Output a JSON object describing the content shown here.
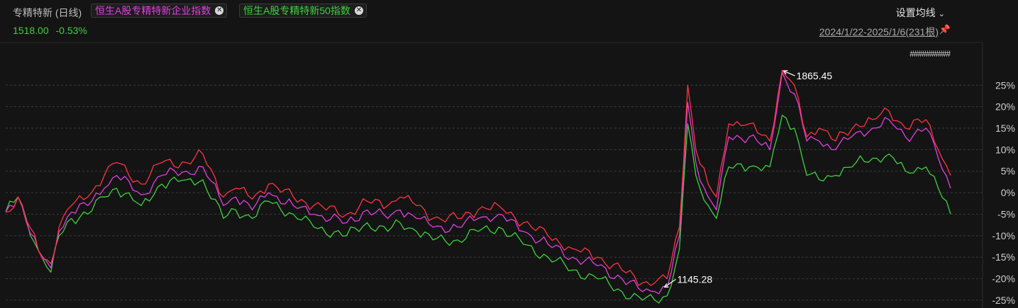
{
  "header": {
    "title": "专精特新 (日线)",
    "tags": [
      {
        "label": "恒生A股专精特新企业指数",
        "color": "#e040e0"
      },
      {
        "label": "恒生A股专精特新50指数",
        "color": "#3fd03f"
      }
    ],
    "settings_label": "设置均线",
    "range_label": "2024/1/22-2025/1/6(231根)",
    "strip_label": "##########"
  },
  "quote": {
    "price": "1518.00",
    "change": "-0.53%"
  },
  "colors": {
    "series_main": "#ff3344",
    "series_magenta": "#e040e0",
    "series_green": "#3fd03f",
    "grid": "#3a3a3a",
    "axis_text": "#cfcfcf"
  },
  "chart_data": {
    "type": "line",
    "ylim": [
      -26,
      29
    ],
    "yticks": [
      25,
      20,
      15,
      10,
      5,
      0,
      -5,
      -10,
      -15,
      -20,
      -25
    ],
    "ytick_labels": [
      "25%",
      "20%",
      "15%",
      "10%",
      "5%",
      "0%",
      "-5%",
      "-10%",
      "-15%",
      "-20%",
      "-25%"
    ],
    "grid": true,
    "x_count": 231,
    "annotations": [
      {
        "label": "1865.45",
        "x": 189,
        "y": 28.5,
        "side": "right"
      },
      {
        "label": "1145.28",
        "x": 160,
        "y": -21.8,
        "side": "right"
      }
    ],
    "anchors": {
      "main": [
        [
          0,
          -4.5
        ],
        [
          3,
          -1
        ],
        [
          8,
          -13.5
        ],
        [
          11,
          -16.5
        ],
        [
          13,
          -8
        ],
        [
          16,
          -3
        ],
        [
          20,
          -1
        ],
        [
          24,
          4
        ],
        [
          27,
          7
        ],
        [
          33,
          2
        ],
        [
          38,
          7
        ],
        [
          44,
          7
        ],
        [
          48,
          9
        ],
        [
          53,
          -1
        ],
        [
          56,
          1
        ],
        [
          60,
          -1.5
        ],
        [
          64,
          2
        ],
        [
          70,
          -1
        ],
        [
          75,
          -3
        ],
        [
          83,
          -5
        ],
        [
          88,
          -2
        ],
        [
          93,
          -3
        ],
        [
          96,
          -1
        ],
        [
          100,
          -3
        ],
        [
          104,
          -6
        ],
        [
          110,
          -6
        ],
        [
          115,
          -4
        ],
        [
          120,
          -3
        ],
        [
          126,
          -7
        ],
        [
          132,
          -10
        ],
        [
          138,
          -13
        ],
        [
          144,
          -15
        ],
        [
          150,
          -18
        ],
        [
          155,
          -21
        ],
        [
          158,
          -21
        ],
        [
          161,
          -20
        ],
        [
          164,
          -8
        ],
        [
          166,
          25
        ],
        [
          168,
          10
        ],
        [
          171,
          2
        ],
        [
          173,
          -1
        ],
        [
          176,
          16
        ],
        [
          181,
          16
        ],
        [
          186,
          12
        ],
        [
          189,
          28.5
        ],
        [
          192,
          25
        ],
        [
          195,
          13
        ],
        [
          198,
          15
        ],
        [
          202,
          12
        ],
        [
          207,
          16
        ],
        [
          211,
          17
        ],
        [
          215,
          19
        ],
        [
          219,
          15
        ],
        [
          224,
          17
        ],
        [
          227,
          10
        ],
        [
          230,
          4
        ]
      ],
      "magenta": [
        [
          0,
          -4.5
        ],
        [
          3,
          -1
        ],
        [
          8,
          -13.5
        ],
        [
          11,
          -17.5
        ],
        [
          13,
          -9
        ],
        [
          16,
          -4.5
        ],
        [
          20,
          -3
        ],
        [
          24,
          1
        ],
        [
          27,
          4
        ],
        [
          33,
          -0.5
        ],
        [
          38,
          4
        ],
        [
          44,
          5
        ],
        [
          48,
          6
        ],
        [
          53,
          -3
        ],
        [
          56,
          -1
        ],
        [
          60,
          -4
        ],
        [
          64,
          0
        ],
        [
          70,
          -3
        ],
        [
          75,
          -5
        ],
        [
          83,
          -7
        ],
        [
          88,
          -4
        ],
        [
          93,
          -6
        ],
        [
          96,
          -4
        ],
        [
          100,
          -6
        ],
        [
          104,
          -8
        ],
        [
          110,
          -8
        ],
        [
          115,
          -6
        ],
        [
          120,
          -5
        ],
        [
          126,
          -9
        ],
        [
          132,
          -12
        ],
        [
          138,
          -15
        ],
        [
          144,
          -17
        ],
        [
          150,
          -20
        ],
        [
          155,
          -23
        ],
        [
          158,
          -23
        ],
        [
          161,
          -22
        ],
        [
          164,
          -10
        ],
        [
          166,
          21
        ],
        [
          168,
          7
        ],
        [
          171,
          -1
        ],
        [
          173,
          -4
        ],
        [
          176,
          13
        ],
        [
          181,
          13
        ],
        [
          186,
          10
        ],
        [
          189,
          28
        ],
        [
          192,
          23
        ],
        [
          195,
          12
        ],
        [
          198,
          12
        ],
        [
          202,
          10
        ],
        [
          207,
          14
        ],
        [
          211,
          15
        ],
        [
          215,
          17
        ],
        [
          219,
          13
        ],
        [
          224,
          15
        ],
        [
          227,
          8
        ],
        [
          230,
          1
        ]
      ],
      "green": [
        [
          0,
          -4.5
        ],
        [
          3,
          -1
        ],
        [
          8,
          -13.5
        ],
        [
          11,
          -18.5
        ],
        [
          13,
          -10
        ],
        [
          16,
          -6
        ],
        [
          20,
          -5
        ],
        [
          24,
          -1
        ],
        [
          27,
          1
        ],
        [
          33,
          -3
        ],
        [
          38,
          2
        ],
        [
          44,
          3
        ],
        [
          48,
          3
        ],
        [
          53,
          -6
        ],
        [
          56,
          -4
        ],
        [
          60,
          -6
        ],
        [
          64,
          -2
        ],
        [
          70,
          -5
        ],
        [
          75,
          -8
        ],
        [
          83,
          -10
        ],
        [
          88,
          -7
        ],
        [
          93,
          -9
        ],
        [
          96,
          -7
        ],
        [
          100,
          -9
        ],
        [
          104,
          -11
        ],
        [
          110,
          -11
        ],
        [
          115,
          -9
        ],
        [
          120,
          -8
        ],
        [
          126,
          -12
        ],
        [
          132,
          -15
        ],
        [
          138,
          -18
        ],
        [
          144,
          -20
        ],
        [
          150,
          -23
        ],
        [
          155,
          -25
        ],
        [
          158,
          -25
        ],
        [
          161,
          -24
        ],
        [
          164,
          -13
        ],
        [
          166,
          16
        ],
        [
          168,
          4
        ],
        [
          171,
          -3
        ],
        [
          173,
          -6
        ],
        [
          176,
          6
        ],
        [
          181,
          6
        ],
        [
          186,
          6
        ],
        [
          189,
          18
        ],
        [
          192,
          15
        ],
        [
          195,
          4
        ],
        [
          198,
          3
        ],
        [
          202,
          4
        ],
        [
          207,
          7
        ],
        [
          211,
          8
        ],
        [
          215,
          9
        ],
        [
          219,
          5
        ],
        [
          224,
          6
        ],
        [
          227,
          1
        ],
        [
          230,
          -5
        ]
      ]
    }
  }
}
